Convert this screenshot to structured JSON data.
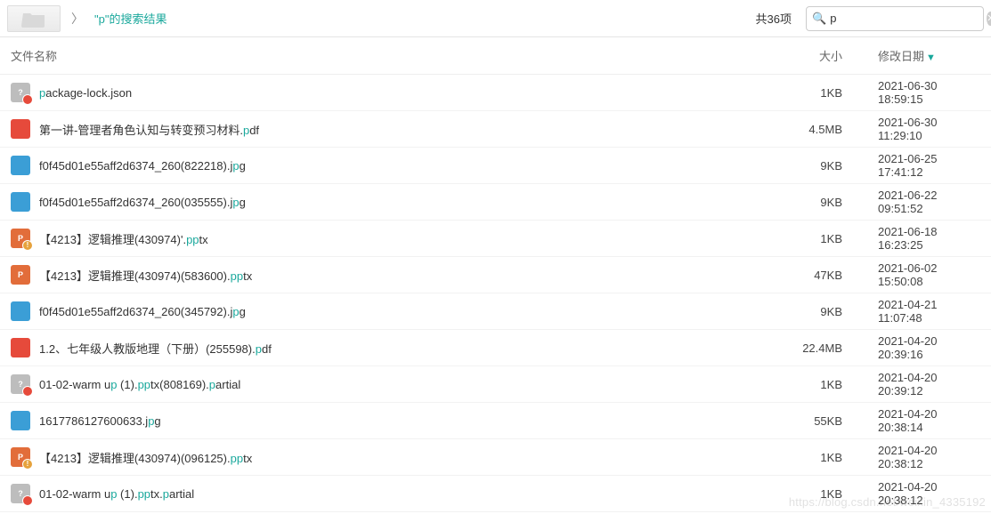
{
  "toolbar": {
    "breadcrumb_label": "\"p\"的搜索结果",
    "item_count": "共36项",
    "search_value": "p"
  },
  "columns": {
    "name": "文件名称",
    "size": "大小",
    "date": "修改日期"
  },
  "files": [
    {
      "icon_type": "unknown",
      "icon_glyph": "?",
      "badge": "badge",
      "name_parts": [
        {
          "t": "p",
          "h": true
        },
        {
          "t": "ackage-lock.json",
          "h": false
        }
      ],
      "size": "1KB",
      "date": "2021-06-30 18:59:15"
    },
    {
      "icon_type": "pdf",
      "icon_glyph": "",
      "badge": "",
      "name_parts": [
        {
          "t": "第一讲-管理者角色认知与转变预习材料.",
          "h": false
        },
        {
          "t": "p",
          "h": true
        },
        {
          "t": "df",
          "h": false
        }
      ],
      "size": "4.5MB",
      "date": "2021-06-30 11:29:10"
    },
    {
      "icon_type": "img",
      "icon_glyph": "",
      "badge": "",
      "name_parts": [
        {
          "t": "f0f45d01e55aff2d6374_260(822218).j",
          "h": false
        },
        {
          "t": "p",
          "h": true
        },
        {
          "t": "g",
          "h": false
        }
      ],
      "size": "9KB",
      "date": "2021-06-25 17:41:12"
    },
    {
      "icon_type": "img",
      "icon_glyph": "",
      "badge": "",
      "name_parts": [
        {
          "t": "f0f45d01e55aff2d6374_260(035555).j",
          "h": false
        },
        {
          "t": "p",
          "h": true
        },
        {
          "t": "g",
          "h": false
        }
      ],
      "size": "9KB",
      "date": "2021-06-22 09:51:52"
    },
    {
      "icon_type": "ppt",
      "icon_glyph": "P",
      "badge": "badge-warn",
      "name_parts": [
        {
          "t": "【4213】逻辑推理(430974)'.",
          "h": false
        },
        {
          "t": "pp",
          "h": true
        },
        {
          "t": "tx",
          "h": false
        }
      ],
      "size": "1KB",
      "date": "2021-06-18 16:23:25"
    },
    {
      "icon_type": "ppt",
      "icon_glyph": "P",
      "badge": "",
      "name_parts": [
        {
          "t": "【4213】逻辑推理(430974)(583600).",
          "h": false
        },
        {
          "t": "pp",
          "h": true
        },
        {
          "t": "tx",
          "h": false
        }
      ],
      "size": "47KB",
      "date": "2021-06-02 15:50:08"
    },
    {
      "icon_type": "img",
      "icon_glyph": "",
      "badge": "",
      "name_parts": [
        {
          "t": "f0f45d01e55aff2d6374_260(345792).j",
          "h": false
        },
        {
          "t": "p",
          "h": true
        },
        {
          "t": "g",
          "h": false
        }
      ],
      "size": "9KB",
      "date": "2021-04-21 11:07:48"
    },
    {
      "icon_type": "pdf",
      "icon_glyph": "",
      "badge": "",
      "name_parts": [
        {
          "t": "1.2、七年级人教版地理（下册）(255598).",
          "h": false
        },
        {
          "t": "p",
          "h": true
        },
        {
          "t": "df",
          "h": false
        }
      ],
      "size": "22.4MB",
      "date": "2021-04-20 20:39:16"
    },
    {
      "icon_type": "unknown",
      "icon_glyph": "?",
      "badge": "badge",
      "name_parts": [
        {
          "t": "01-02-warm u",
          "h": false
        },
        {
          "t": "p",
          "h": true
        },
        {
          "t": " (1).",
          "h": false
        },
        {
          "t": "pp",
          "h": true
        },
        {
          "t": "tx(808169).",
          "h": false
        },
        {
          "t": "p",
          "h": true
        },
        {
          "t": "artial",
          "h": false
        }
      ],
      "size": "1KB",
      "date": "2021-04-20 20:39:12"
    },
    {
      "icon_type": "img",
      "icon_glyph": "",
      "badge": "",
      "name_parts": [
        {
          "t": "1617786127600633.j",
          "h": false
        },
        {
          "t": "p",
          "h": true
        },
        {
          "t": "g",
          "h": false
        }
      ],
      "size": "55KB",
      "date": "2021-04-20 20:38:14"
    },
    {
      "icon_type": "ppt",
      "icon_glyph": "P",
      "badge": "badge-warn",
      "name_parts": [
        {
          "t": "【4213】逻辑推理(430974)(096125).",
          "h": false
        },
        {
          "t": "pp",
          "h": true
        },
        {
          "t": "tx",
          "h": false
        }
      ],
      "size": "1KB",
      "date": "2021-04-20 20:38:12"
    },
    {
      "icon_type": "unknown",
      "icon_glyph": "?",
      "badge": "badge",
      "name_parts": [
        {
          "t": "01-02-warm u",
          "h": false
        },
        {
          "t": "p",
          "h": true
        },
        {
          "t": " (1).",
          "h": false
        },
        {
          "t": "pp",
          "h": true
        },
        {
          "t": "tx.",
          "h": false
        },
        {
          "t": "p",
          "h": true
        },
        {
          "t": "artial",
          "h": false
        }
      ],
      "size": "1KB",
      "date": "2021-04-20 20:38:12"
    }
  ],
  "watermark": "https://blog.csdn.net/weixin_4335192"
}
